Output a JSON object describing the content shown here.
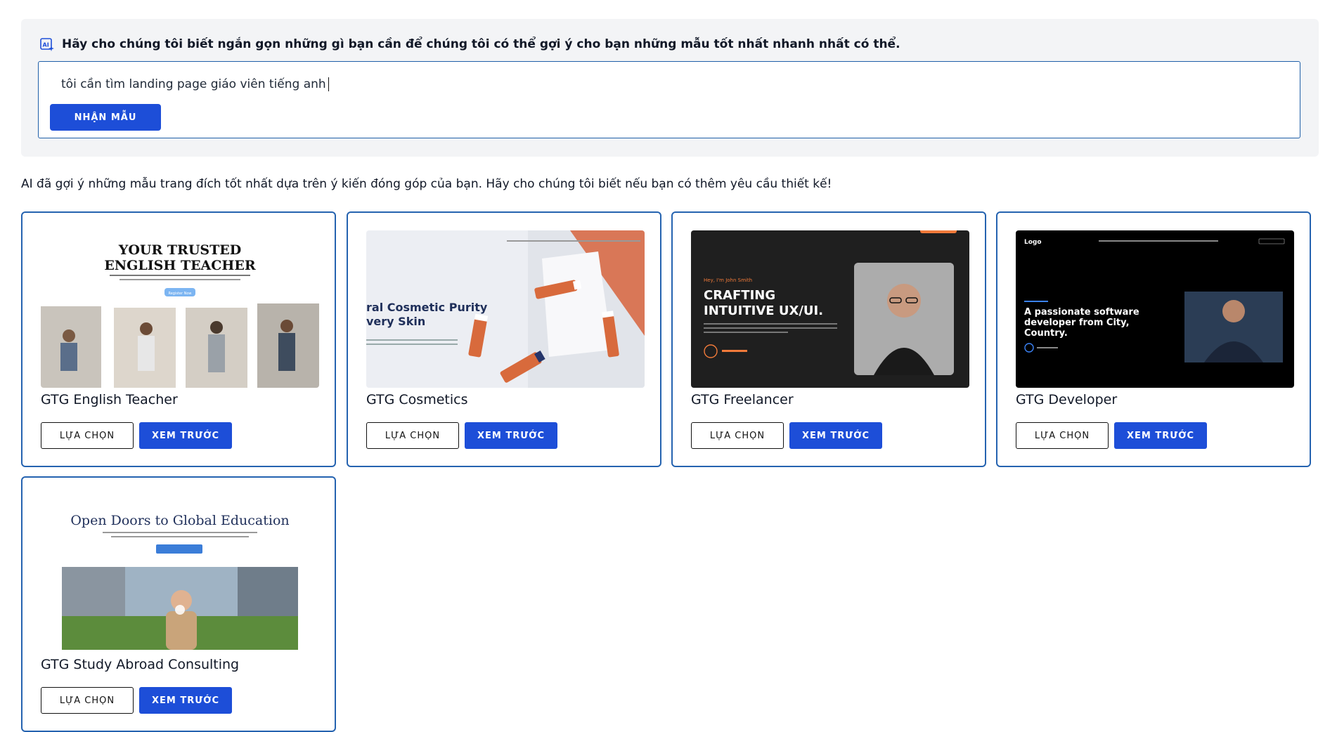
{
  "ai_prompt": {
    "header": "Hãy cho chúng tôi biết ngắn gọn những gì bạn cần để chúng tôi có thể gợi ý cho bạn những mẫu tốt nhất nhanh nhất có thể.",
    "input_value": "tôi cần tìm landing page giáo viên tiếng anh",
    "submit_label": "NHẬN MẪU"
  },
  "result_message": "AI đã gợi ý những mẫu trang đích tốt nhất dựa trên ý kiến đóng góp của bạn. Hãy cho chúng tôi biết nếu bạn có thêm yêu cầu thiết kế!",
  "templates": [
    {
      "name": "GTG English Teacher",
      "choose_label": "LỰA CHỌN",
      "preview_label": "XEM TRƯỚC",
      "thumb": {
        "heading_1": "YOUR TRUSTED",
        "heading_2": "ENGLISH TEACHER",
        "button": "Register Now"
      }
    },
    {
      "name": "GTG Cosmetics",
      "choose_label": "LỰA CHỌN",
      "preview_label": "XEM TRƯỚC",
      "thumb": {
        "heading_1": "ral Cosmetic Purity",
        "heading_2": "very Skin"
      }
    },
    {
      "name": "GTG Freelancer",
      "choose_label": "LỰA CHỌN",
      "preview_label": "XEM TRƯỚC",
      "thumb": {
        "kicker": "Hey, I'm John Smith",
        "heading_1": "CRAFTING",
        "heading_2": "INTUITIVE UX/UI."
      }
    },
    {
      "name": "GTG Developer",
      "choose_label": "LỰA CHỌN",
      "preview_label": "XEM TRƯỚC",
      "thumb": {
        "logo": "Logo",
        "heading_1": "A passionate software",
        "heading_2": "developer from City,",
        "heading_3": "Country."
      }
    },
    {
      "name": "GTG Study Abroad Consulting",
      "choose_label": "LỰA CHỌN",
      "preview_label": "XEM TRƯỚC",
      "thumb": {
        "heading_1": "Open Doors to Global Education"
      }
    }
  ],
  "colors": {
    "accent": "#1d4ed8",
    "card_border": "#2563b0",
    "panel_bg": "#f3f4f6"
  }
}
